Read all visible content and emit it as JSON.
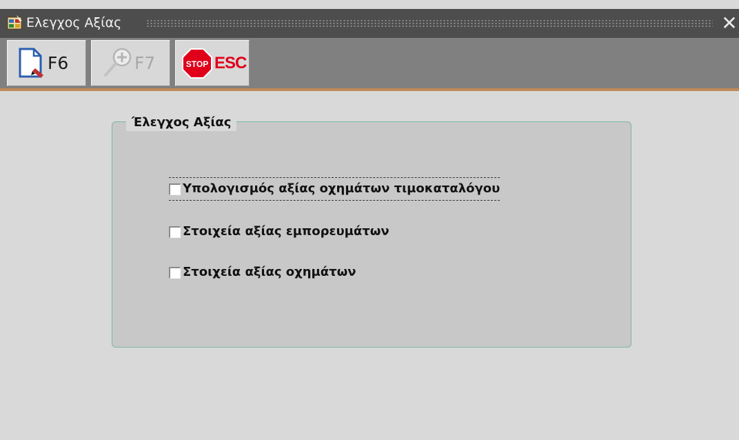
{
  "window": {
    "title": "Ελεγχος Αξίας",
    "close_icon": "close-icon"
  },
  "toolbar": {
    "buttons": [
      {
        "key": "F6",
        "icon": "new-document-icon",
        "enabled": true
      },
      {
        "key": "F7",
        "icon": "search-zoom-in-icon",
        "enabled": false
      },
      {
        "key": "ESC",
        "icon": "stop-sign-icon",
        "enabled": true,
        "badge": "STOP"
      }
    ]
  },
  "group": {
    "title": "Έλεγχος Αξίας",
    "options": [
      {
        "label": "Υπολογισμός αξίας οχημάτων τιμοκαταλόγου",
        "checked": false,
        "focused": true
      },
      {
        "label": "Στοιχεία αξίας εμπορευμάτων",
        "checked": false,
        "focused": false
      },
      {
        "label": "Στοιχεία αξίας οχημάτων",
        "checked": false,
        "focused": false
      }
    ]
  },
  "colors": {
    "titlebar": "#4d4d4d",
    "toolbar": "#808080",
    "accent_line": "#c08a56",
    "background": "#d9d9d9",
    "group_border": "#7fb5a8",
    "stop_red": "#e0001a"
  }
}
